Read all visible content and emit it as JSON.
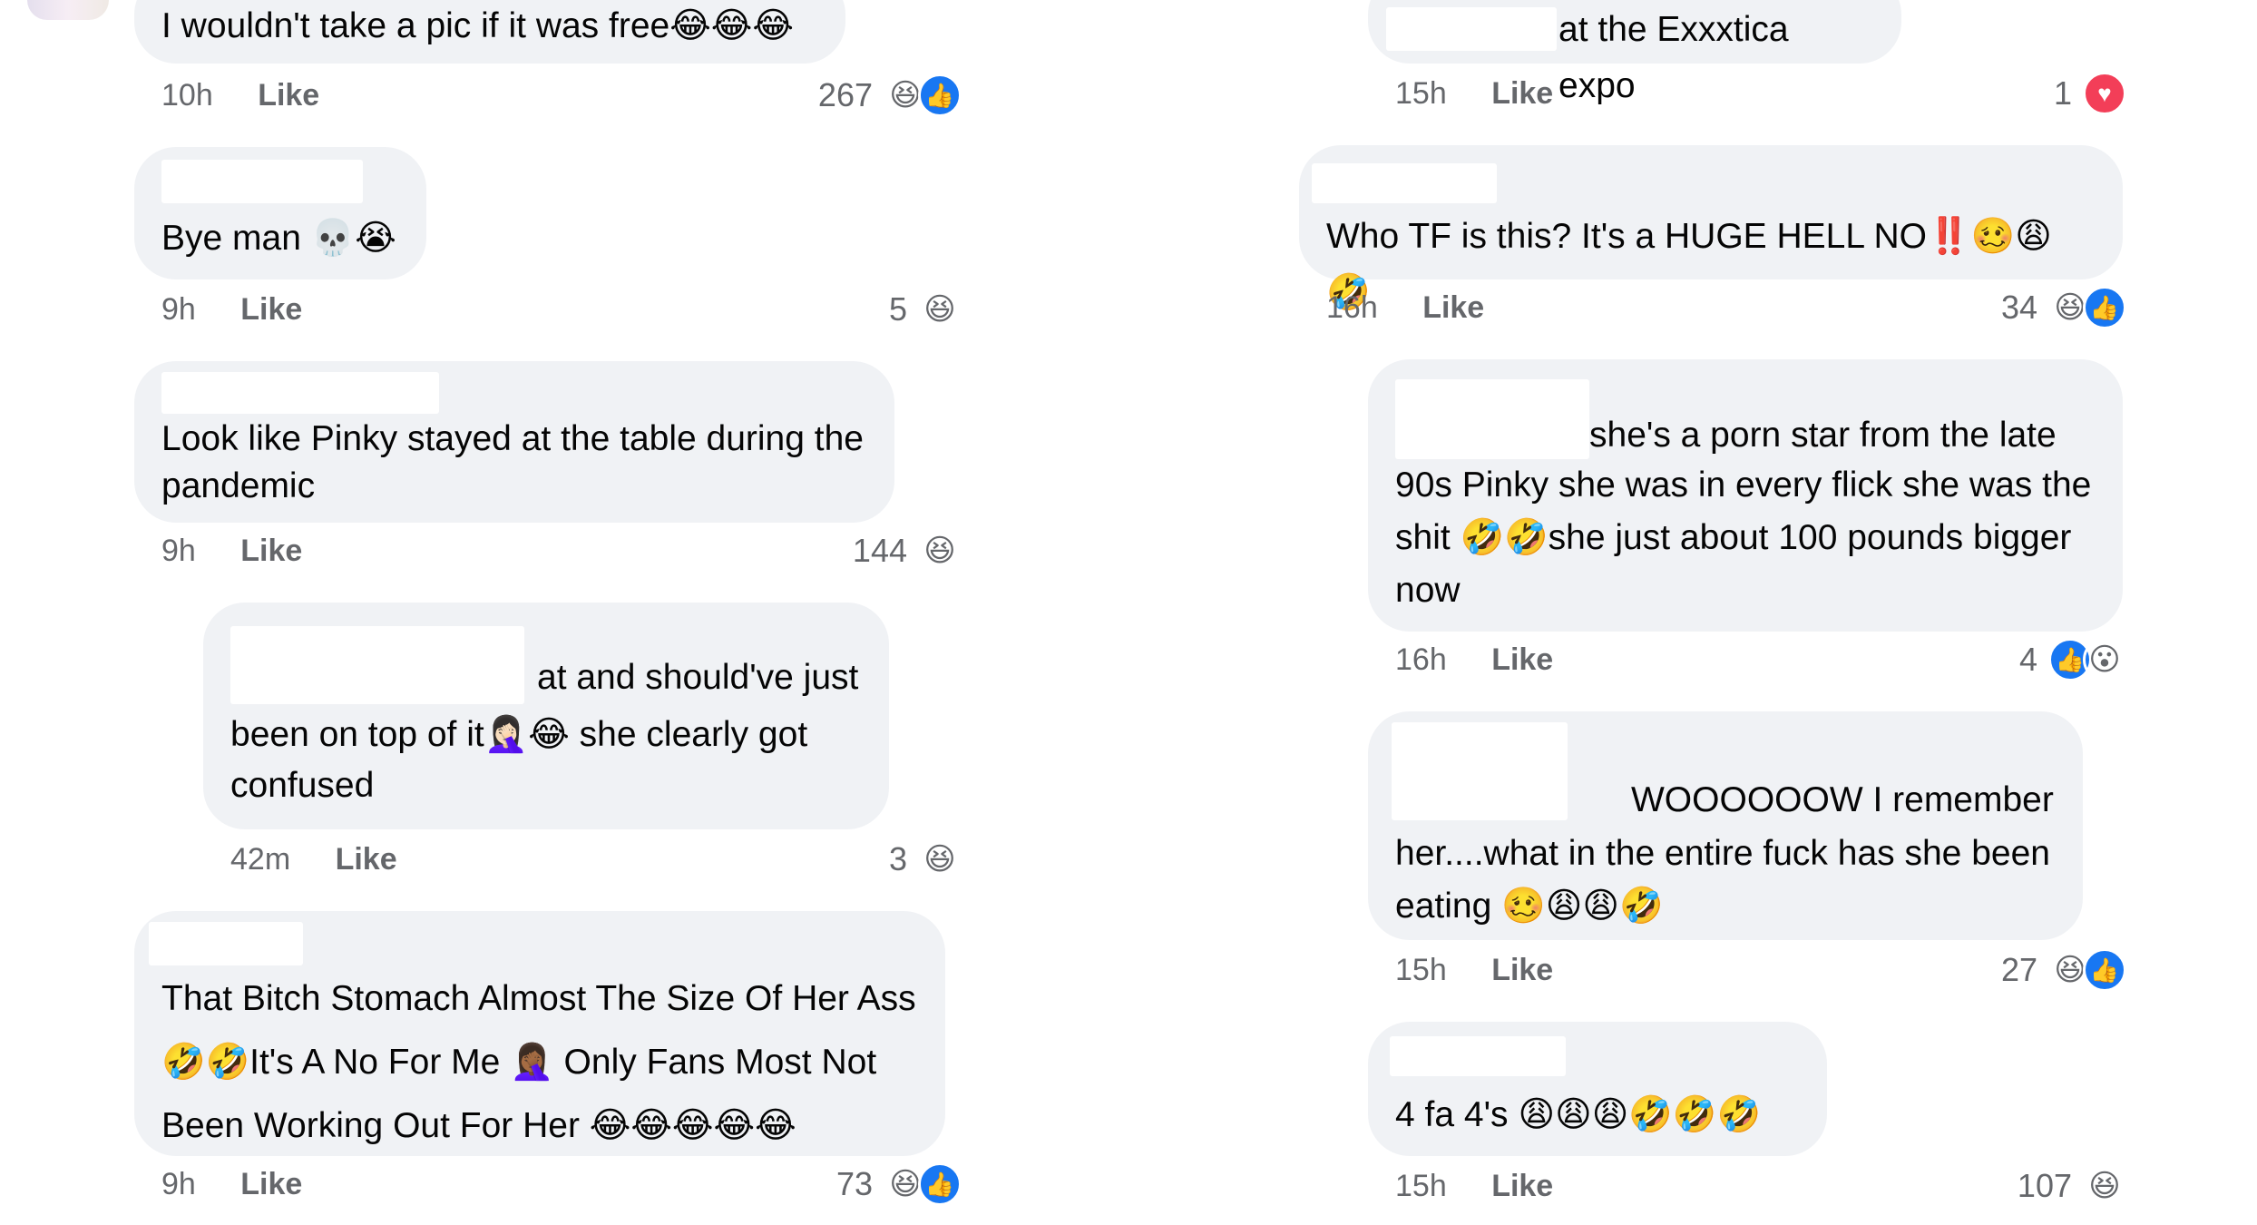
{
  "comments_left": [
    {
      "text": "I wouldn't take a pic if it was free😂😂😂",
      "time": "10h",
      "like": "Like",
      "count": "267",
      "reactions": [
        "laugh-reaction-icon",
        "thumbs-up-reaction-icon"
      ]
    },
    {
      "text": "Bye man 💀😭",
      "time": "9h",
      "like": "Like",
      "count": "5",
      "reactions": [
        "laugh-reaction-icon"
      ]
    },
    {
      "text": "Look like Pinky stayed at the table during the pandemic",
      "time": "9h",
      "like": "Like",
      "count": "144",
      "reactions": [
        "laugh-reaction-icon"
      ]
    },
    {
      "text_line1": "at and should've just",
      "text_rest": "been on top of it🤦🏻‍♀️😂 she clearly got confused",
      "time": "42m",
      "like": "Like",
      "count": "3",
      "reactions": [
        "laugh-reaction-icon"
      ]
    },
    {
      "text": "That Bitch Stomach Almost The Size Of Her Ass 🤣🤣It's A No For Me 🤦🏾‍♀️ Only Fans Most Not Been Working Out For Her 😂😂😂😂😂",
      "time": "9h",
      "like": "Like",
      "count": "73",
      "reactions": [
        "laugh-reaction-icon",
        "thumbs-up-reaction-icon"
      ]
    }
  ],
  "comments_right": [
    {
      "text": "at the Exxxtica expo",
      "time": "15h",
      "like": "Like",
      "count": "1",
      "reactions": [
        "heart-reaction-icon"
      ]
    },
    {
      "text": "Who TF is this? It's a HUGE HELL NO‼️🥴😩🤣",
      "time": "16h",
      "like": "Like",
      "count": "34",
      "reactions": [
        "laugh-reaction-icon",
        "thumbs-up-reaction-icon"
      ]
    },
    {
      "text_line1": "she's a porn star from the late",
      "text_rest": "90s Pinky she was in every flick she was the shit 🤣🤣she just about 100 pounds bigger now",
      "time": "16h",
      "like": "Like",
      "count": "4",
      "reactions": [
        "thumbs-up-reaction-icon",
        "wow-reaction-icon"
      ]
    },
    {
      "text_line1": "WOOOOOOW I remember",
      "text_rest": "her....what in the entire fuck has she been eating 🥴😩😩🤣",
      "time": "15h",
      "like": "Like",
      "count": "27",
      "reactions": [
        "laugh-reaction-icon",
        "thumbs-up-reaction-icon"
      ]
    },
    {
      "text": "4 fa 4's 😩😩😩🤣🤣🤣",
      "time": "15h",
      "like": "Like",
      "count": "107",
      "reactions": [
        "laugh-reaction-icon"
      ]
    }
  ],
  "reaction_glyphs": {
    "laugh": "😆",
    "thumbs_up": "👍",
    "heart": "♥",
    "wow": "😮"
  },
  "colors": {
    "bubble": "#f0f2f5",
    "meta_text": "#65676b",
    "like_blue": "#1877f2",
    "love_red": "#f33e58"
  }
}
